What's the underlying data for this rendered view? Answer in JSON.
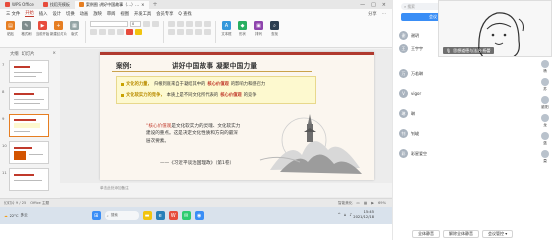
{
  "wps": {
    "tabs": [
      {
        "label": "WPS Office",
        "color": "#e74c3c"
      },
      {
        "label": "找稻壳模板",
        "color": "#e74c3c"
      },
      {
        "label": "案例图 讲好中国故事（…）…",
        "color": "#e67e22"
      }
    ],
    "menu": [
      "三 文件",
      "开始",
      "插入",
      "设计",
      "切换",
      "动画",
      "放映",
      "审阅",
      "视图",
      "开发工具",
      "会员专享",
      "Q 查找"
    ],
    "menu_active_index": 1,
    "menu_right": [
      "分享",
      "…"
    ],
    "ribbon": {
      "buttons": [
        {
          "label": "粘贴",
          "color": "#e67e22"
        },
        {
          "label": "格式刷",
          "color": "#7f8c8d"
        },
        {
          "label": "当前开始",
          "color": "#e74c3c"
        },
        {
          "label": "新建幻灯片",
          "color": "#e67e22"
        },
        {
          "label": "版式",
          "color": "#95a5a6"
        }
      ],
      "font_value": "",
      "size_value": "0",
      "right_buttons": [
        {
          "label": "文本框",
          "color": "#3498db"
        },
        {
          "label": "形状",
          "color": "#27ae60"
        },
        {
          "label": "排列",
          "color": "#8e44ad"
        },
        {
          "label": "查找",
          "color": "#2c3e50"
        }
      ]
    },
    "panel": {
      "tab_outline": "大纲",
      "tab_slides": "幻灯片"
    },
    "thumb_numbers": [
      "7",
      "8",
      "9",
      "10",
      "11"
    ],
    "slide": {
      "case_label": "案例:",
      "title": "讲好中国故事   凝聚中国力量",
      "bullets": [
        {
          "lead": "文化的力量，",
          "text": "归根到底来自于凝结其中的",
          "hl": "核心价值观",
          "tail": "的影响力和感召力"
        },
        {
          "lead": "文化软实力的竞争，",
          "text": "本质上是不同文化所代表的",
          "hl": "核心价值观",
          "tail": "的竞争"
        }
      ],
      "quote_quote": "“",
      "quote_hl": "核心价值观",
      "quote_rest": "是文化软实力的灵魂、文化软实力建设的重点。这是决定文化性质和方向的最深层次要素。",
      "quote_source": "——《习近平谈治国理政》（第1卷）"
    },
    "notes_placeholder": "单击此处添加备注",
    "status": {
      "left": "幻灯片 9 / 25",
      "theme": "Office 主题",
      "right": "智能美化",
      "zoom": "69%"
    }
  },
  "taskbar": {
    "weather_temp": "22°C",
    "weather_text": "多云",
    "search": "搜索",
    "apps": [
      {
        "name": "explorer",
        "color": "#f1c40f"
      },
      {
        "name": "edge",
        "color": "#2980b9"
      },
      {
        "name": "wps",
        "color": "#e74c3c"
      },
      {
        "name": "chat",
        "color": "#2ecc71"
      },
      {
        "name": "meeting",
        "color": "#3a8ef6"
      }
    ],
    "time": "15:45",
    "date": "2021/12/18"
  },
  "meeting": {
    "search_placeholder": "搜索",
    "blue_button": "会议",
    "video_caption": "思想道德与法治-杨蕾",
    "participants": [
      {
        "name": "谢玥",
        "initial": "谢"
      },
      {
        "name": "王宇宇",
        "initial": "王"
      },
      {
        "name": "万若琳",
        "initial": "万"
      },
      {
        "name": "vigor",
        "initial": "V"
      },
      {
        "name": "琳",
        "initial": "琳"
      },
      {
        "name": "钊峻",
        "initial": "钊"
      },
      {
        "name": "彩星爱空",
        "initial": "彩"
      }
    ],
    "right_col": [
      "杨",
      "苏",
      "欧阳",
      "龙",
      "蓝",
      "莫"
    ],
    "bottom_buttons": [
      "全体静音",
      "解除全体静音",
      "会议管控 ▾"
    ]
  }
}
